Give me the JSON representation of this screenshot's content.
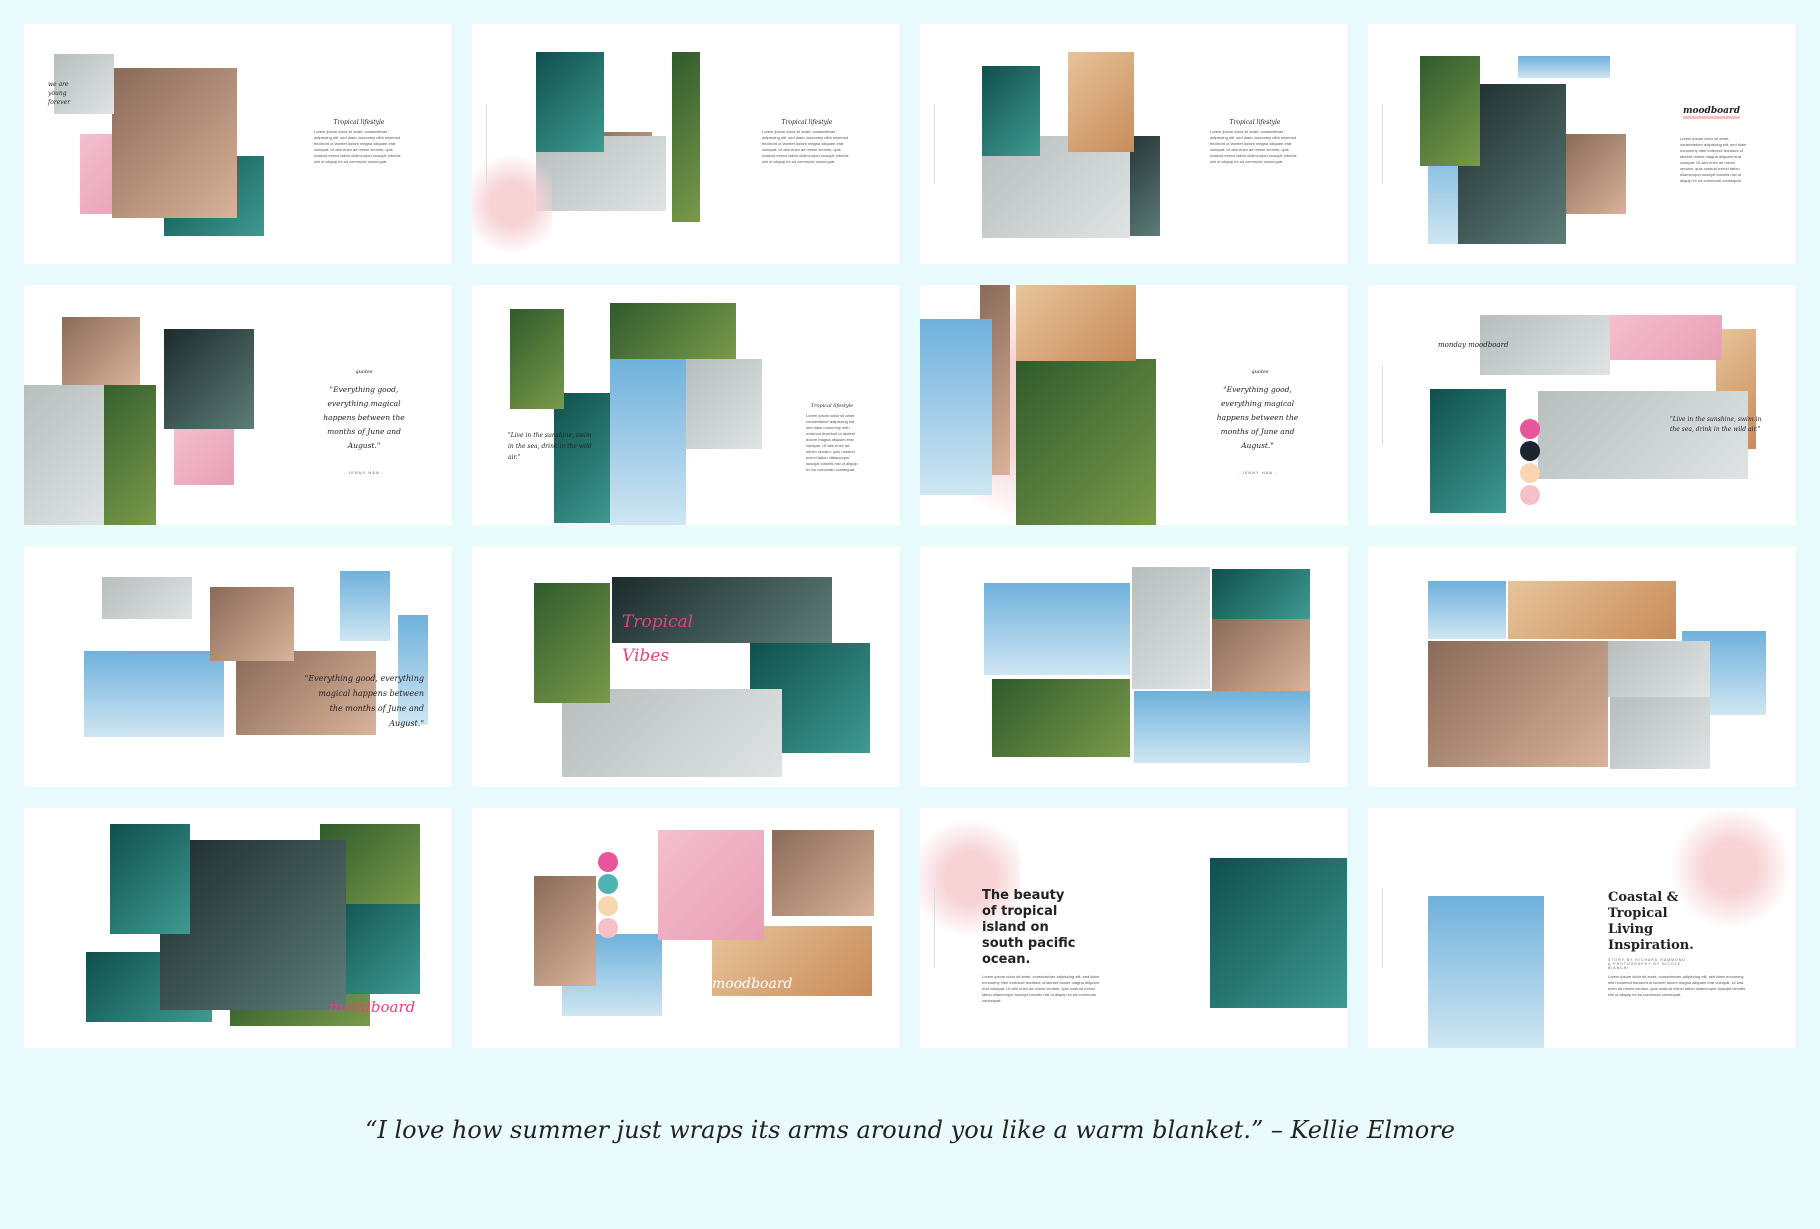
{
  "lorem": "Lorem ipsum dolor sit amet, consectetuer adipiscing elit, sed diam nonummy nibh euismod tincidunt ut laoreet dolore magna aliquam erat volutpat. Ut wisi enim ad minim veniam, quis nostrud exerci tation ullamcorper suscipit lobortis nisl ut aliquip ex ea commodo consequat.",
  "slides": {
    "s1": {
      "heading": "Tropical lifestyle",
      "handwritten": "we are young forever"
    },
    "s2": {
      "heading": "Tropical lifestyle"
    },
    "s3": {
      "heading": "Tropical lifestyle"
    },
    "s4": {
      "heading": "moodboard"
    },
    "s5": {
      "heading": "quotes",
      "quote": "\"Everything good, everything magical happens between the months of June and August.\"",
      "author": "- JENNY HAN -"
    },
    "s6": {
      "heading": "Tropical lifestyle",
      "quote": "\"Live in the sunshine, swim in the sea, drink in the wild air.\""
    },
    "s7": {
      "heading": "quotes",
      "quote": "\"Everything good, everything magical happens between the months of June and August.\"",
      "author": "- JENNY HAN -"
    },
    "s8": {
      "heading": "monday moodboard",
      "quote": "\"Live in the sunshine, swim in the sea, drink in the wild air.\""
    },
    "s9": {
      "quote": "\"Everything good, everything magical happens between the months of June and August.\""
    },
    "s10": {
      "title": "Tropical Vibes"
    },
    "s13": {
      "title": "moodboard"
    },
    "s14": {
      "title": "moodboard"
    },
    "s15": {
      "title": "The beauty of tropical island on south pacific ocean."
    },
    "s16": {
      "title": "Coastal & Tropical Living Inspiration.",
      "credits": "STORY BY RICHARD HAMMOND & PHOTOGRAPHY BY NICOLE BIANCHI"
    }
  },
  "palette": [
    "#e8559a",
    "#1c2430",
    "#f7d6b0",
    "#f6c1c5"
  ],
  "palette2": [
    "#e8559a",
    "#4fb3b3",
    "#f7d6b0",
    "#f6c1c5"
  ],
  "accent_pink": "#e0457b",
  "footer_quote": "“I love how summer just wraps its arms around you like a warm blanket.” – Kellie Elmore"
}
